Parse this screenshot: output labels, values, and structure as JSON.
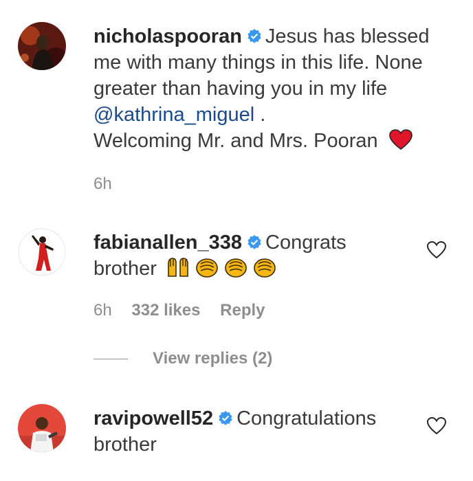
{
  "comments": [
    {
      "username": "nicholaspooran",
      "text_line1": "Jesus has blessed",
      "text_line2": "me with many things in this life. None",
      "text_line3": "greater than having you in my life",
      "mention": "@kathrina_miguel",
      "after_mention": " .",
      "text_line5": "Welcoming Mr. and Mrs. Pooran",
      "time": "6h"
    },
    {
      "username": "fabianallen_338",
      "text_line1": "Congrats",
      "text_line2": "brother",
      "time": "6h",
      "likes": "332 likes",
      "reply_label": "Reply",
      "view_replies": "View replies (2)"
    },
    {
      "username": "ravipowell52",
      "text_line1": "Congratulations",
      "text_line2": "brother"
    }
  ],
  "icons": {
    "verified": "verified-badge-icon",
    "heart_emoji": "red-heart-emoji",
    "like": "heart-outline-icon",
    "raised_hands": "raised-hands-emoji",
    "clap": "clapping-hands-emoji"
  },
  "colors": {
    "verified": "#3897f0",
    "mention": "#1a4a8a",
    "muted": "#8e8e8e",
    "heart": "#e0162b"
  }
}
